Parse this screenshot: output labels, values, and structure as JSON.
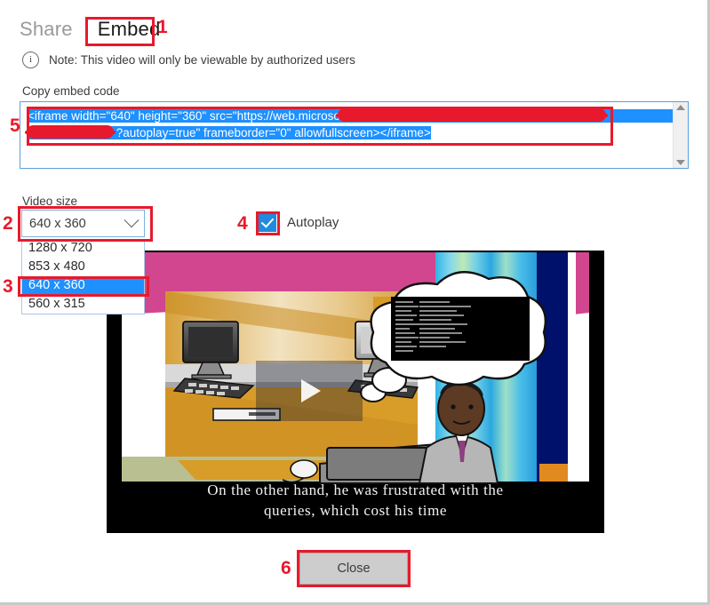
{
  "tabs": [
    {
      "label": "Share",
      "active": false
    },
    {
      "label": "Embed",
      "active": true
    }
  ],
  "note": {
    "icon": "info-circle-icon",
    "text": "Note: This video will only be viewable by authorized users"
  },
  "embed": {
    "label": "Copy embed code",
    "line1_pre": "<iframe width=\"640\" height=\"360\" src=\"https://web.microsoftstream.com/embed/#/",
    "line1_redacted": "████████████████████████████████",
    "line2_redacted": "██████████████",
    "line2_post": "?autoplay=true\" frameborder=\"0\" allowfullscreen></iframe>",
    "scroll_up_icon": "scroll-up-arrow-icon",
    "scroll_down_icon": "scroll-down-arrow-icon"
  },
  "video_size": {
    "label": "Video size",
    "selected": "640 x 360",
    "chevron_icon": "chevron-down-icon",
    "options": [
      {
        "label": "1280 x 720",
        "highlighted": false
      },
      {
        "label": "853 x 480",
        "highlighted": false
      },
      {
        "label": "640 x 360",
        "highlighted": true
      },
      {
        "label": "560 x 315",
        "highlighted": false
      }
    ]
  },
  "autoplay": {
    "label": "Autoplay",
    "checked": true
  },
  "video": {
    "caption_line1": "On the other hand, he was frustrated with the",
    "caption_line2": "queries, which cost his time",
    "play_icon": "play-triangle-icon"
  },
  "footer": {
    "close_label": "Close"
  },
  "annotations": [
    {
      "number": "1",
      "target": "embed-tab"
    },
    {
      "number": "2",
      "target": "video-size-select"
    },
    {
      "number": "3",
      "target": "option-640x360"
    },
    {
      "number": "4",
      "target": "autoplay-checkbox"
    },
    {
      "number": "5",
      "target": "embed-code-text"
    },
    {
      "number": "6",
      "target": "close-button"
    }
  ],
  "colors": {
    "accent_blue": "#1e90ff",
    "annotation_red": "#e8192c",
    "checkbox_blue": "#1e8ae0"
  }
}
